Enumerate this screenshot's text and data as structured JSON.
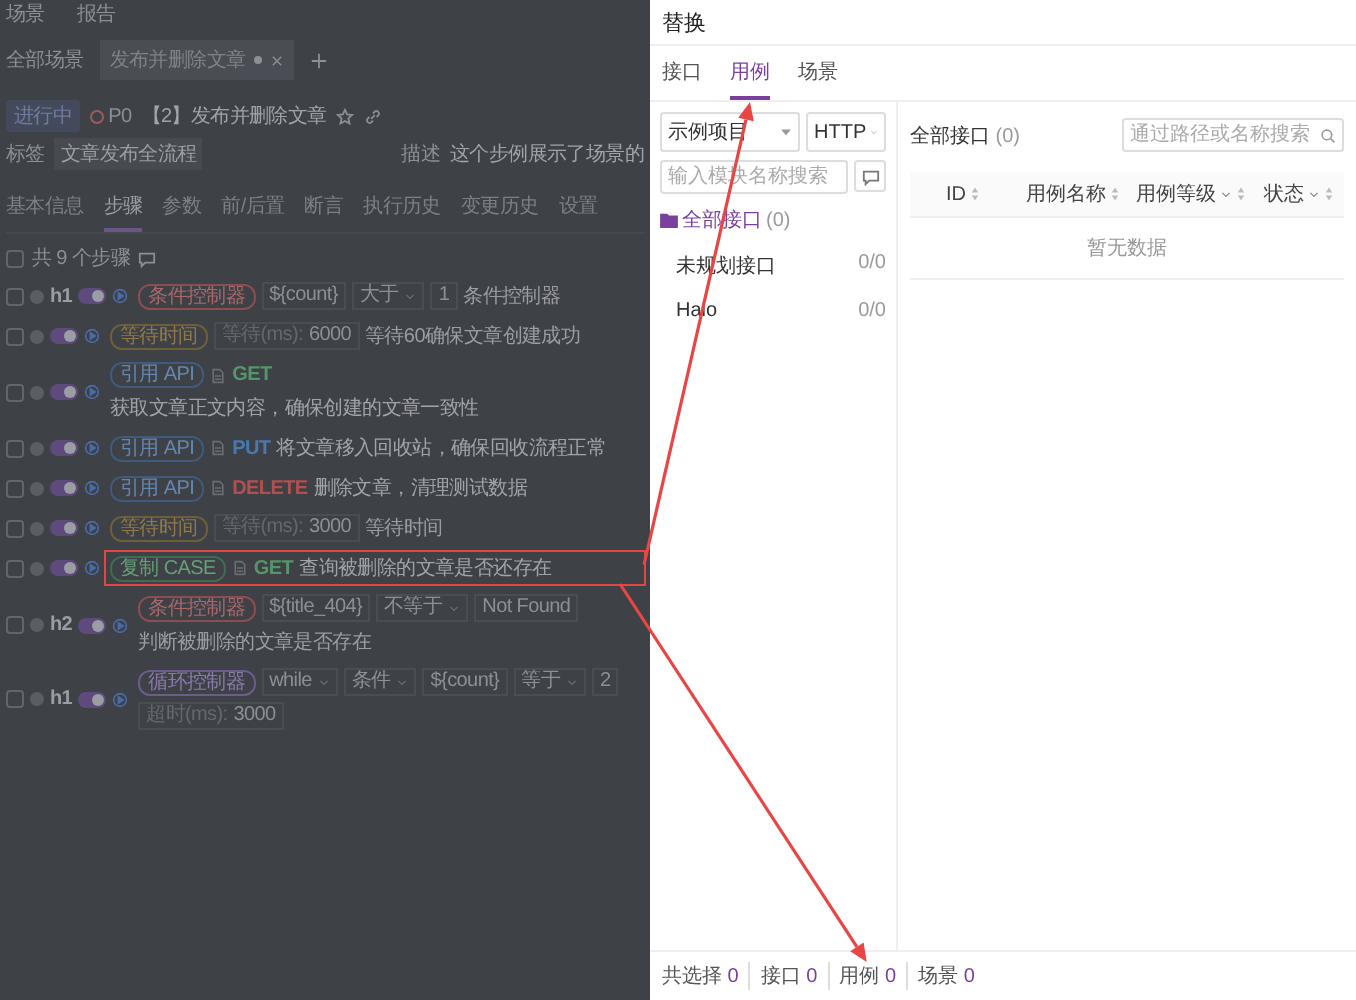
{
  "top_nav": [
    "场景",
    "报告"
  ],
  "scenario_tabs": [
    {
      "label": "全部场景",
      "kind": "link",
      "unsaved": false
    },
    {
      "label": "发布并删除文章",
      "kind": "open",
      "unsaved": true
    }
  ],
  "scenario": {
    "status": "进行中",
    "priority": "P0",
    "title": "【2】发布并删除文章",
    "tag_label": "标签",
    "tags": [
      "文章发布全流程"
    ],
    "description_label": "描述",
    "description": "这个步例展示了场景的"
  },
  "tabs": [
    {
      "label": "基本信息",
      "selected": false
    },
    {
      "label": "步骤",
      "selected": true
    },
    {
      "label": "参数",
      "selected": false
    },
    {
      "label": "前/后置",
      "selected": false
    },
    {
      "label": "断言",
      "selected": false
    },
    {
      "label": "执行历史",
      "selected": false
    },
    {
      "label": "变更历史",
      "selected": false
    },
    {
      "label": "设置",
      "selected": false
    }
  ],
  "steps_summary": "共 9 个步骤",
  "all_checked": false,
  "steps": [
    {
      "kind": "condition",
      "level_label": "h1",
      "checked": false,
      "enabled": true,
      "highlighted": false,
      "tag": "条件控制器",
      "fields": [
        {
          "kind": "input",
          "value": "${count}"
        },
        {
          "kind": "select",
          "value": "大于"
        },
        {
          "kind": "input",
          "value": "1"
        }
      ],
      "note": "条件控制器"
    },
    {
      "kind": "wait",
      "checked": false,
      "enabled": true,
      "highlighted": false,
      "tag": "等待时间",
      "fields": [
        {
          "kind": "input",
          "label": "等待(ms):",
          "value": "6000"
        }
      ],
      "note": "等待60确保文章创建成功"
    },
    {
      "kind": "api",
      "checked": false,
      "enabled": true,
      "highlighted": false,
      "tag": "引用 API",
      "method": "GET",
      "text": "获取文章正文内容，确保创建的文章一致性"
    },
    {
      "kind": "api",
      "checked": false,
      "enabled": true,
      "highlighted": false,
      "tag": "引用 API",
      "method": "PUT",
      "text": "将文章移入回收站，确保回收流程正常"
    },
    {
      "kind": "api",
      "checked": false,
      "enabled": true,
      "highlighted": false,
      "tag": "引用 API",
      "method": "DELETE",
      "text": "删除文章，清理测试数据"
    },
    {
      "kind": "wait",
      "checked": false,
      "enabled": true,
      "highlighted": false,
      "tag": "等待时间",
      "fields": [
        {
          "kind": "input",
          "label": "等待(ms):",
          "value": "3000"
        }
      ],
      "note": "等待时间"
    },
    {
      "kind": "case",
      "checked": false,
      "enabled": true,
      "highlighted": true,
      "tag": "复制 CASE",
      "method": "GET",
      "text": "查询被删除的文章是否还存在"
    },
    {
      "kind": "condition",
      "level_label": "h2",
      "checked": false,
      "enabled": true,
      "highlighted": false,
      "tag": "条件控制器",
      "fields": [
        {
          "kind": "input",
          "value": "${title_404}"
        },
        {
          "kind": "select",
          "value": "不等于"
        },
        {
          "kind": "input",
          "value": "Not Found"
        }
      ],
      "note": "判断被删除的文章是否存在"
    },
    {
      "kind": "loop",
      "level_label": "h1",
      "checked": false,
      "enabled": true,
      "highlighted": false,
      "tag": "循环控制器",
      "fields": [
        {
          "kind": "select",
          "value": "while"
        },
        {
          "kind": "select",
          "value": "条件"
        },
        {
          "kind": "input",
          "value": "${count}"
        },
        {
          "kind": "select",
          "value": "等于"
        },
        {
          "kind": "input",
          "value": "2"
        },
        {
          "kind": "input",
          "label": "超时(ms):",
          "value": "3000"
        }
      ]
    }
  ],
  "drawer": {
    "title": "替换",
    "tabs": [
      {
        "label": "接口",
        "selected": false
      },
      {
        "label": "用例",
        "selected": true
      },
      {
        "label": "场景",
        "selected": false
      }
    ],
    "module_select": "示例项目",
    "protocol_select": "HTTP",
    "module_search_placeholder": "输入模块名称搜索",
    "tree": [
      {
        "label": "全部接口",
        "count": "(0)",
        "selected": true,
        "children": [
          {
            "label": "未规划接口",
            "count": "0/0",
            "selected": false
          },
          {
            "label": "Halo",
            "count": "0/0",
            "selected": false
          }
        ]
      }
    ],
    "list_title": "全部接口",
    "list_count": "(0)",
    "list_search_placeholder": "通过路径或名称搜索",
    "columns": [
      {
        "label": "ID",
        "filter": false
      },
      {
        "label": "用例名称",
        "filter": false
      },
      {
        "label": "用例等级",
        "filter": true
      },
      {
        "label": "状态",
        "filter": true
      }
    ],
    "empty_text": "暂无数据",
    "footer": [
      {
        "label": "共选择",
        "count": "0"
      },
      {
        "label": "接口",
        "count": "0"
      },
      {
        "label": "用例",
        "count": "0"
      },
      {
        "label": "场景",
        "count": "0"
      }
    ]
  }
}
